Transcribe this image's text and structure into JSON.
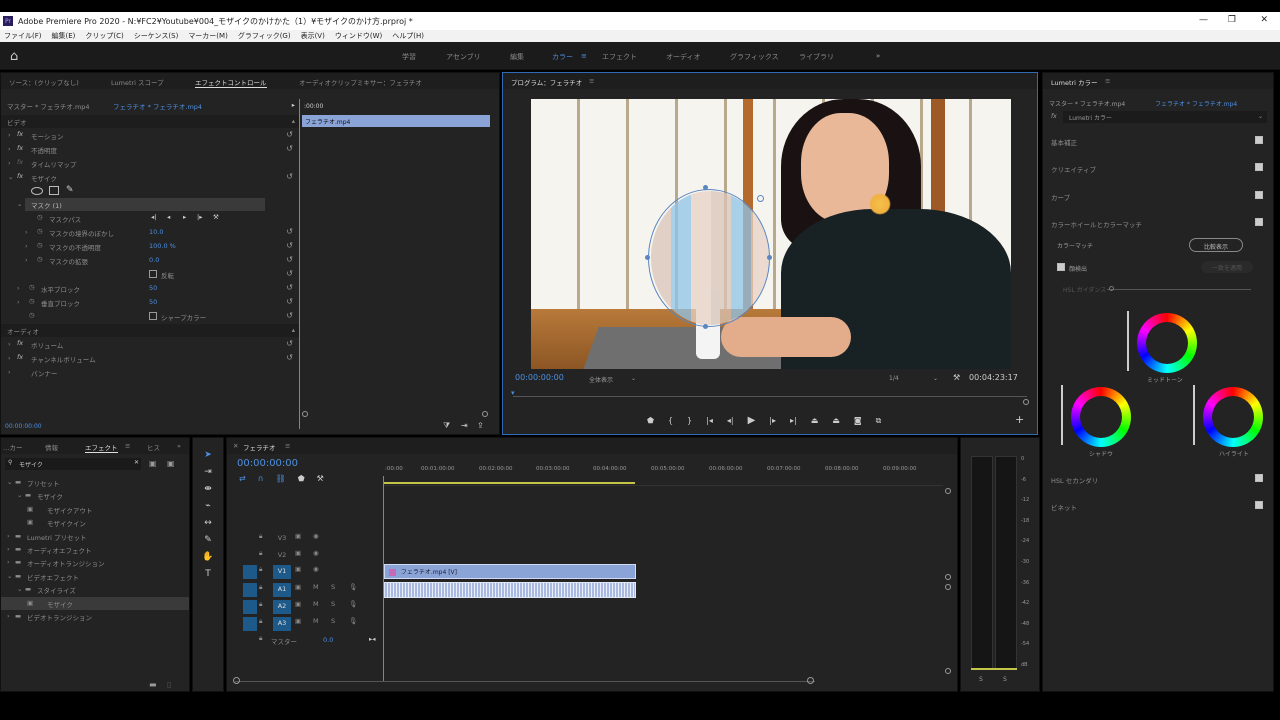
{
  "app": {
    "title": "Adobe Premiere Pro 2020 - N:¥FC2¥Youtube¥004_モザイクのかけかた（1）¥モザイクのかけ方.prproj *"
  },
  "menu": [
    "ファイル(F)",
    "編集(E)",
    "クリップ(C)",
    "シーケンス(S)",
    "マーカー(M)",
    "グラフィック(G)",
    "表示(V)",
    "ウィンドウ(W)",
    "ヘルプ(H)"
  ],
  "workspaces": [
    "学習",
    "アセンブリ",
    "編集",
    "カラー",
    "エフェクト",
    "オーディオ",
    "グラフィックス",
    "ライブラリ"
  ],
  "active_workspace": "カラー",
  "source_panel": {
    "tabs": [
      "ソース：(クリップなし)",
      "Lumetri スコープ",
      "エフェクトコントロール",
      "オーディオクリップミキサー：フェラチオ"
    ],
    "master": "マスター * フェラチオ.mp4",
    "clip": "フェラチオ * フェラチオ.mp4",
    "timecode_start": ":00:00",
    "clip_bar": "フェラチオ.mp4",
    "video_header": "ビデオ",
    "motion": "モーション",
    "opacity": "不透明度",
    "time_remap": "タイムリマップ",
    "mosaic": "モザイク",
    "mask": "マスク (1)",
    "mask_path": "マスクパス",
    "mask_feather": "マスクの境界のぼかし",
    "mask_feather_val": "10.0",
    "mask_opacity": "マスクの不透明度",
    "mask_opacity_val": "100.0 %",
    "mask_expansion": "マスクの拡張",
    "mask_expansion_val": "0.0",
    "invert": "反転",
    "h_blocks": "水平ブロック",
    "h_blocks_val": "50",
    "v_blocks": "垂直ブロック",
    "v_blocks_val": "50",
    "sharp": "シャープカラー",
    "audio_header": "オーディオ",
    "volume": "ボリューム",
    "channel_volume": "チャンネルボリューム",
    "panner": "パンナー",
    "bottom_tc": "00:00:00:00"
  },
  "program": {
    "tab": "プログラム：フェラチオ",
    "timecode": "00:00:00:00",
    "fit": "全体表示",
    "quality": "1/4",
    "duration": "00:04:23:17"
  },
  "lumetri": {
    "tab": "Lumetri カラー",
    "master": "マスター * フェラチオ.mp4",
    "clip": "フェラチオ * フェラチオ.mp4",
    "effect": "Lumetri カラー",
    "sections": [
      "基本補正",
      "クリエイティブ",
      "カーブ",
      "カラーホイールとカラーマッチ"
    ],
    "color_match": "カラーマッチ",
    "compare": "比較表示",
    "face_detect": "顔検出",
    "apply_match": "一致を適用",
    "hsl_label": "HSL ガイダンス",
    "midtones": "ミッドトーン",
    "shadows": "シャドウ",
    "highlights": "ハイライト",
    "hsl_secondary": "HSL セカンダリ",
    "vignette": "ビネット"
  },
  "effects_panel": {
    "tabs": [
      "…カー",
      "情報",
      "エフェクト",
      "ヒス"
    ],
    "search": "モザイク",
    "tree": [
      {
        "label": "プリセット",
        "level": 0
      },
      {
        "label": "モザイク",
        "level": 1
      },
      {
        "label": "モザイクアウト",
        "level": 2
      },
      {
        "label": "モザイクイン",
        "level": 2
      },
      {
        "label": "Lumetri プリセット",
        "level": 0
      },
      {
        "label": "オーディオエフェクト",
        "level": 0
      },
      {
        "label": "オーディオトランジション",
        "level": 0
      },
      {
        "label": "ビデオエフェクト",
        "level": 0
      },
      {
        "label": "スタイライズ",
        "level": 1
      },
      {
        "label": "モザイク",
        "level": 2
      },
      {
        "label": "ビデオトランジション",
        "level": 0
      }
    ]
  },
  "timeline": {
    "tab": "フェラチオ",
    "timecode": "00:00:00:00",
    "ruler": [
      ":00:00",
      "00:01:00:00",
      "00:02:00:00",
      "00:03:00:00",
      "00:04:00:00",
      "00:05:00:00",
      "00:06:00:00",
      "00:07:00:00",
      "00:08:00:00",
      "00:09:00:00"
    ],
    "tracks": [
      "V3",
      "V2",
      "V1",
      "A1",
      "A2",
      "A3"
    ],
    "master_label": "マスター",
    "master_val": "0.0",
    "clip_label": "フェラチオ.mp4 [V]"
  },
  "meter": {
    "scale": [
      "0",
      "-6",
      "-12",
      "-18",
      "-24",
      "-30",
      "-36",
      "-42",
      "-48",
      "-54",
      "dB"
    ],
    "bottom": [
      "S",
      "S"
    ]
  },
  "colors": {
    "accent": "#4d8fe0",
    "panel": "#232323",
    "clip_video": "#8aa4d8",
    "clip_audio": "#a9b9e0",
    "track_active": "#1d5a8a"
  }
}
